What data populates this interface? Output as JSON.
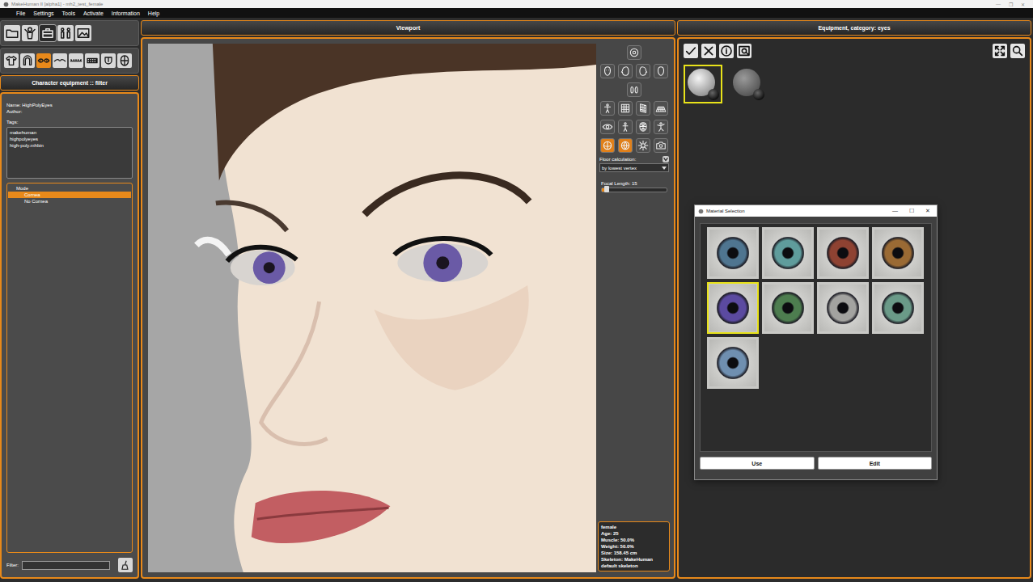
{
  "window": {
    "title": "MakeHuman II [alpha1] - mh2_test_female",
    "controls": [
      "—",
      "❐",
      "✕"
    ]
  },
  "menu": [
    "File",
    "Settings",
    "Tools",
    "Activate",
    "Information",
    "Help"
  ],
  "main_toolbar": [
    {
      "selected": false
    },
    {
      "selected": false
    },
    {
      "selected": true
    },
    {
      "selected": false
    },
    {
      "selected": false
    }
  ],
  "category_toolbar": [
    {
      "selected": false
    },
    {
      "selected": false
    },
    {
      "selected": true
    },
    {
      "selected": false
    },
    {
      "selected": false
    },
    {
      "selected": false
    },
    {
      "selected": false
    },
    {
      "selected": false
    }
  ],
  "left_panel": {
    "header": "Character equipment :: filter",
    "name": "Name: HighPolyEyes",
    "author": "Author:",
    "tags_label": "Tags:",
    "tags": [
      "makehuman",
      "highpolyeyes",
      "high-poly.mhbin"
    ],
    "mode": {
      "label": "Mode",
      "options": [
        {
          "label": "Cornea",
          "selected": true
        },
        {
          "label": "No Cornea",
          "selected": false
        }
      ]
    },
    "filter_label": "Filter:"
  },
  "viewport": {
    "header": "Viewport",
    "tools": [
      [
        {
          "on": false
        }
      ],
      [
        {
          "on": false
        },
        {
          "on": false
        },
        {
          "on": false
        },
        {
          "on": false
        }
      ],
      [
        {
          "on": false
        }
      ],
      [
        {
          "on": false
        },
        {
          "on": false
        },
        {
          "on": false
        },
        {
          "on": false
        }
      ],
      [
        {
          "on": false
        },
        {
          "on": false
        },
        {
          "on": false
        },
        {
          "on": false
        }
      ],
      [
        {
          "on": true
        },
        {
          "on": true
        },
        {
          "on": false
        },
        {
          "on": false
        }
      ]
    ],
    "floor": {
      "label": "Floor calculation:",
      "value": "by lowest vertex"
    },
    "focal": {
      "label": "Focal Length: 15",
      "level": 0.08
    },
    "info": [
      "female",
      "Age: 25",
      "Muscle: 50.0%",
      "Weight: 50.0%",
      "Size: 158.45 cm",
      "Skeleton: MakeHuman",
      "default skeleton"
    ]
  },
  "equipment": {
    "header": "Equipment, category: eyes",
    "items": [
      {
        "selected": true
      },
      {
        "selected": false
      }
    ]
  },
  "dialog": {
    "title": "Material Selection",
    "controls": [
      "—",
      "☐",
      "✕"
    ],
    "materials": [
      {
        "color": "#4f7590",
        "selected": false
      },
      {
        "color": "#5f9c9c",
        "selected": false
      },
      {
        "color": "#8e4232",
        "selected": false
      },
      {
        "color": "#9a6a34",
        "selected": false
      },
      {
        "color": "#5b4aa0",
        "selected": true
      },
      {
        "color": "#4d7d4f",
        "selected": false
      },
      {
        "color": "#a3a3a0",
        "selected": false
      },
      {
        "color": "#6a9a88",
        "selected": false
      },
      {
        "color": "#6f8fb0",
        "selected": false
      }
    ],
    "buttons": [
      "Use",
      "Edit"
    ]
  }
}
